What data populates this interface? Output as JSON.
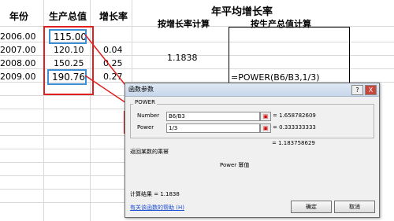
{
  "sheet": {
    "col_year": "年份",
    "col_total": "生产总值",
    "col_growth": "增长率",
    "rows": [
      {
        "year": "2006.00",
        "total": "115.00",
        "growth": ""
      },
      {
        "year": "2007.00",
        "total": "120.10",
        "growth": "0.04"
      },
      {
        "year": "2008.00",
        "total": "150.25",
        "growth": "0.25"
      },
      {
        "year": "2009.00",
        "total": "190.76",
        "growth": "0.27"
      }
    ],
    "avg_title": "年平均增长率",
    "by_rate": "按增长率计算",
    "by_total": "按生产总值计算",
    "rate_value": "1.1838",
    "formula": "=POWER(B6/B3,1/3)"
  },
  "dialog": {
    "title": "函数参数",
    "func_name": "POWER",
    "number_label": "Number",
    "number_value": "B6/B3",
    "number_result": "= 1.658782609",
    "power_label": "Power",
    "power_value": "1/3",
    "power_result": "= 0.333333333",
    "total_result": "= 1.183758629",
    "desc": "返回某数的乘幂",
    "param_desc": "Power  幂值",
    "calc_result": "计算结果 = 1.1838",
    "help_link": "有关该函数的帮助 (H)",
    "ok": "确定",
    "cancel": "取消",
    "help_btn": "?",
    "close_btn": "X"
  },
  "colors": {
    "highlight": "#e02020",
    "selection": "#3d8fd6"
  }
}
